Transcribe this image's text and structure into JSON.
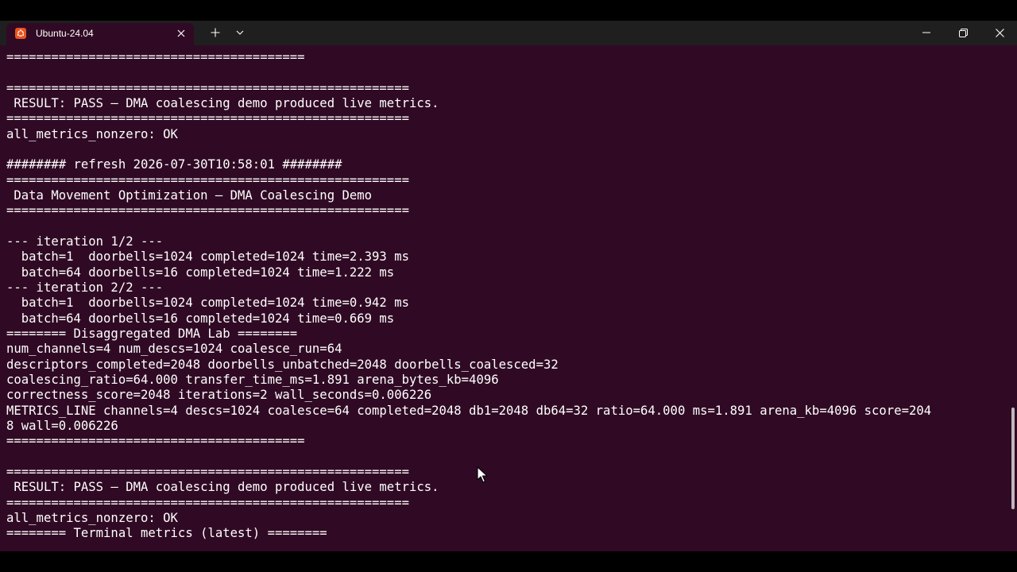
{
  "window": {
    "tab_title": "Ubuntu-24.04",
    "icons": {
      "tab": "ubuntu-icon",
      "close_tab": "close-icon",
      "new_tab": "plus-icon",
      "dropdown": "chevron-down-icon",
      "minimize": "minimize-icon",
      "maximize": "restore-icon",
      "close_window": "close-icon"
    }
  },
  "colors": {
    "terminal_background": "#300a24",
    "titlebar_background": "#1f1f1f",
    "text": "#ffffff",
    "accent": "#e95420"
  },
  "terminal": {
    "lines": [
      "========================================",
      "",
      "======================================================",
      " RESULT: PASS — DMA coalescing demo produced live metrics.",
      "======================================================",
      "all_metrics_nonzero: OK",
      "",
      "######## refresh 2026-07-30T10:58:01 ########",
      "======================================================",
      " Data Movement Optimization — DMA Coalescing Demo",
      "======================================================",
      "",
      "--- iteration 1/2 ---",
      "  batch=1  doorbells=1024 completed=1024 time=2.393 ms",
      "  batch=64 doorbells=16 completed=1024 time=1.222 ms",
      "--- iteration 2/2 ---",
      "  batch=1  doorbells=1024 completed=1024 time=0.942 ms",
      "  batch=64 doorbells=16 completed=1024 time=0.669 ms",
      "======== Disaggregated DMA Lab ========",
      "num_channels=4 num_descs=1024 coalesce_run=64",
      "descriptors_completed=2048 doorbells_unbatched=2048 doorbells_coalesced=32",
      "coalescing_ratio=64.000 transfer_time_ms=1.891 arena_bytes_kb=4096",
      "correctness_score=2048 iterations=2 wall_seconds=0.006226",
      "METRICS_LINE channels=4 descs=1024 coalesce=64 completed=2048 db1=2048 db64=32 ratio=64.000 ms=1.891 arena_kb=4096 score=204",
      "8 wall=0.006226",
      "========================================",
      "",
      "======================================================",
      " RESULT: PASS — DMA coalescing demo produced live metrics.",
      "======================================================",
      "all_metrics_nonzero: OK",
      "======== Terminal metrics (latest) ========"
    ]
  }
}
